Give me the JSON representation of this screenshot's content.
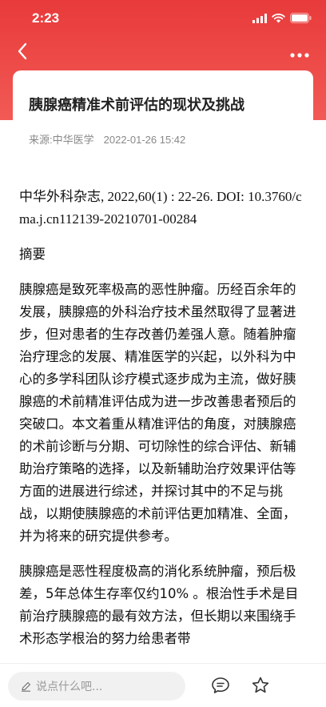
{
  "status_bar": {
    "time": "2:23"
  },
  "nav": {
    "back_icon": "chevron-left-icon",
    "more_icon": "more-dots-icon"
  },
  "article": {
    "title": "胰腺癌精准术前评估的现状及挑战",
    "source": "来源:中华医学",
    "date": "2022-01-26 15:42",
    "citation": "中华外科杂志, 2022,60(1) : 22-26. DOI: 10.3760/cma.j.cn112139-20210701-00284",
    "section_heading": "摘要",
    "paragraph_1": "胰腺癌是致死率极高的恶性肿瘤。历经百余年的发展，胰腺癌的外科治疗技术虽然取得了显著进步，但对患者的生存改善仍差强人意。随着肿瘤治疗理念的发展、精准医学的兴起，以外科为中心的多学科团队诊疗模式逐步成为主流，做好胰腺癌的术前精准评估成为进一步改善患者预后的突破口。本文着重从精准评估的角度，对胰腺癌的术前诊断与分期、可切除性的综合评估、新辅助治疗策略的选择，以及新辅助治疗效果评估等方面的进展进行综述，并探讨其中的不足与挑战，以期使胰腺癌的术前评估更加精准、全面，并为将来的研究提供参考。",
    "paragraph_2": "胰腺癌是恶性程度极高的消化系统肿瘤，预后极差，5年总体生存率仅约10% 。根治性手术是目前治疗胰腺癌的最有效方法，但长期以来围绕手术形态学根治的努力给患者带"
  },
  "bottom_bar": {
    "comment_placeholder": "说点什么吧...",
    "comment_icon": "comment-icon",
    "favorite_icon": "star-icon"
  },
  "colors": {
    "header_red": "#e83a3a",
    "text_primary": "#111111",
    "text_meta": "#888888"
  }
}
